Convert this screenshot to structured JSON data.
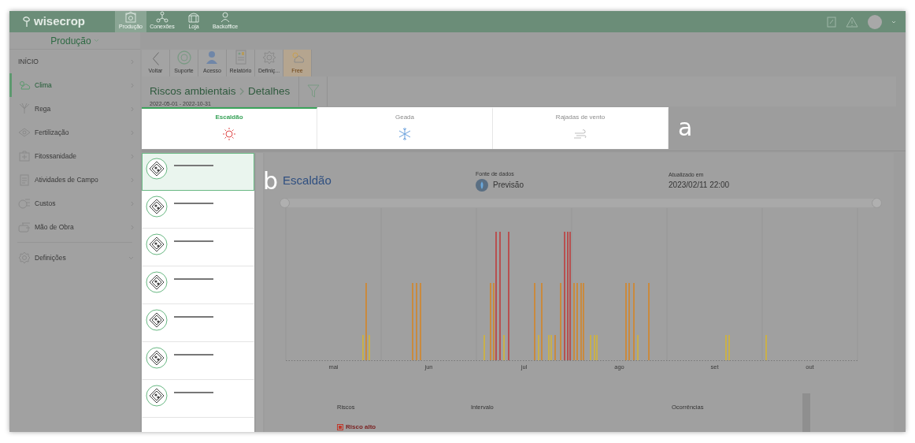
{
  "navbar": {
    "logo": "wisecrop",
    "apps": [
      {
        "label": "Produção",
        "kind": "production",
        "selected": true
      },
      {
        "label": "Conexões",
        "kind": "connections",
        "selected": false
      },
      {
        "label": "Loja",
        "kind": "store",
        "selected": false
      },
      {
        "label": "Backoffice",
        "kind": "backoffice",
        "selected": false
      }
    ]
  },
  "module_menu": {
    "label": "Produção"
  },
  "sidebar": {
    "items": [
      {
        "label": "INÍCIO",
        "kind": "home",
        "selected": false
      },
      {
        "label": "Clima",
        "kind": "weather",
        "selected": true
      },
      {
        "label": "Rega",
        "kind": "irrigation",
        "selected": false
      },
      {
        "label": "Fertilização",
        "kind": "fertilization",
        "selected": false
      },
      {
        "label": "Fitossanidade",
        "kind": "phyto",
        "selected": false
      },
      {
        "label": "Atividades de Campo",
        "kind": "field",
        "selected": false
      },
      {
        "label": "Custos",
        "kind": "costs",
        "selected": false
      },
      {
        "label": "Mão de Obra",
        "kind": "labor",
        "selected": false
      },
      {
        "label": "Definições",
        "kind": "settings",
        "selected": false
      }
    ]
  },
  "toolbar": {
    "buttons": [
      {
        "label": "Voltar",
        "kind": "back"
      },
      {
        "label": "Suporte",
        "kind": "support"
      },
      {
        "label": "Acesso",
        "kind": "access"
      },
      {
        "label": "Relatório",
        "kind": "report"
      },
      {
        "label": "Definiç...",
        "kind": "settings"
      },
      {
        "label": "Free",
        "kind": "plan"
      }
    ]
  },
  "header": {
    "breadcrumb": [
      "Riscos ambientais",
      "Detalhes"
    ],
    "date_range": "2022-05-01 - 2022-10-31"
  },
  "risk_tabs": [
    {
      "label": "Escaldão",
      "kind": "heat",
      "selected": true
    },
    {
      "label": "Geada",
      "kind": "frost",
      "selected": false
    },
    {
      "label": "Rajadas de vento",
      "kind": "wind",
      "selected": false
    }
  ],
  "callouts": [
    "a",
    "b"
  ],
  "parcels": [
    {
      "selected": true
    },
    {
      "selected": false
    },
    {
      "selected": false
    },
    {
      "selected": false
    },
    {
      "selected": false
    },
    {
      "selected": false
    },
    {
      "selected": false
    }
  ],
  "detail": {
    "title": "Escaldão",
    "source_label": "Fonte de dados",
    "source": "Previsão",
    "updated_label": "Atualizado em",
    "updated": "2023/02/11 22:00",
    "range_slider": {
      "level": 1
    },
    "chart": {
      "month_labels": [
        "mai",
        "jun",
        "jul",
        "ago",
        "set",
        "out"
      ]
    },
    "table": {
      "columns": [
        "Riscos",
        "Intervalo",
        "Ocorrências"
      ],
      "rows": [
        {
          "risk": "Risco alto",
          "color": "#c0392b"
        }
      ]
    }
  }
}
